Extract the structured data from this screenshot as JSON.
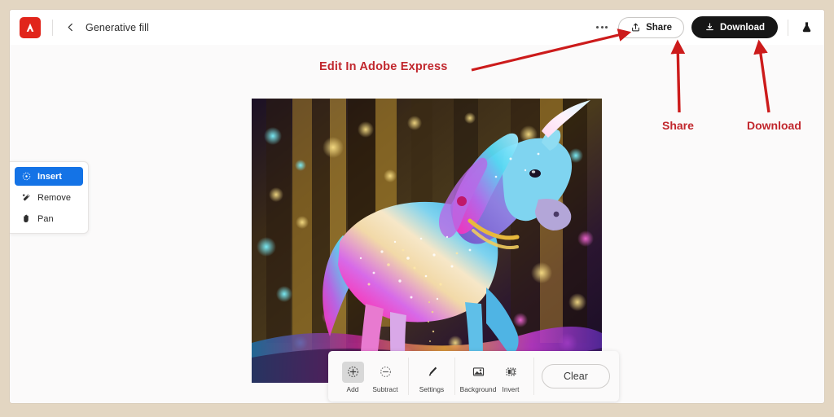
{
  "window": {
    "border_color": "#e3d6c2",
    "background": "#ffffff"
  },
  "header": {
    "logo_name": "adobe-logo",
    "logo_color": "#e1251b",
    "logo_letter": "A",
    "back_label": "‹",
    "title": "Generative fill",
    "more_label": "more-options",
    "share_label": "Share",
    "download_label": "Download",
    "flask_label": "experimental-features"
  },
  "tool_panel": {
    "items": [
      {
        "label": "Insert",
        "icon": "lasso-select-icon",
        "active": true
      },
      {
        "label": "Remove",
        "icon": "magic-wand-icon",
        "active": false
      },
      {
        "label": "Pan",
        "icon": "hand-icon",
        "active": false
      }
    ],
    "active_color": "#1473e6"
  },
  "image": {
    "alt": "AI generated sparkling rainbow unicorn in a glowing bokeh forest",
    "description": "Generative fill result"
  },
  "bottom_toolbar": {
    "tools": [
      {
        "label": "Add",
        "icon": "add-selection-icon",
        "selected": true
      },
      {
        "label": "Subtract",
        "icon": "subtract-selection-icon",
        "selected": false
      },
      {
        "label": "Settings",
        "icon": "brush-icon",
        "selected": false
      },
      {
        "label": "Background",
        "icon": "background-image-icon",
        "selected": false
      },
      {
        "label": "Invert",
        "icon": "invert-selection-icon",
        "selected": false
      }
    ],
    "clear_label": "Clear"
  },
  "annotations": {
    "color": "#c1272d",
    "express": "Edit In Adobe Express",
    "share": "Share",
    "download": "Download"
  }
}
